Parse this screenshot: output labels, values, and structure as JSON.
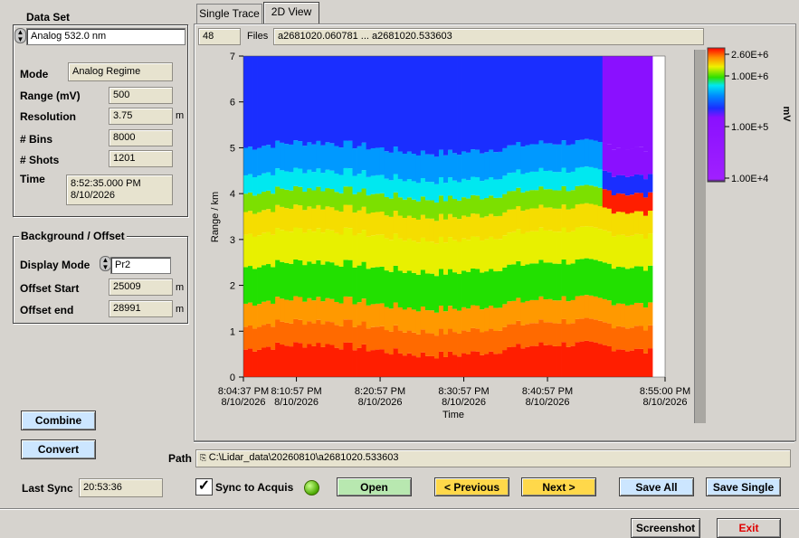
{
  "dataset": {
    "group_label": "Data Set",
    "channel": "Analog 532.0 nm",
    "mode_label": "Mode",
    "mode": "Analog Regime",
    "range_label": "Range (mV)",
    "range": "500",
    "resolution_label": "Resolution",
    "resolution": "3.75",
    "resolution_unit": "m",
    "bins_label": "# Bins",
    "bins": "8000",
    "shots_label": "# Shots",
    "shots": "1201",
    "time_label": "Time",
    "time": "8:52:35.000 PM",
    "date": "8/10/2026"
  },
  "background": {
    "group_label": "Background / Offset",
    "display_mode_label": "Display Mode",
    "display_mode": "Pr2",
    "offset_start_label": "Offset Start",
    "offset_start": "25009",
    "offset_start_unit": "m",
    "offset_end_label": "Offset end",
    "offset_end": "28991",
    "offset_end_unit": "m"
  },
  "buttons": {
    "combine": "Combine",
    "convert": "Convert",
    "open": "Open",
    "previous": "< Previous",
    "next": "Next  >",
    "save_all": "Save All",
    "save_single": "Save Single",
    "screenshot": "Screenshot",
    "exit": "Exit"
  },
  "tabs": [
    "Single Trace",
    "2D View"
  ],
  "files": {
    "count": "48",
    "label": "Files",
    "range": "a2681020.060781 ... a2681020.533603"
  },
  "path": {
    "label": "Path",
    "value": "C:\\Lidar_data\\20260810\\a2681020.533603"
  },
  "sync": {
    "last_sync_label": "Last Sync",
    "last_sync": "20:53:36",
    "checkbox_label": "Sync to Acquis",
    "checked": true
  },
  "chart_data": {
    "type": "heatmap",
    "ylabel": "Range / km",
    "xlabel": "Time",
    "ylim": [
      0,
      7
    ],
    "y_ticks": [
      "0",
      "1",
      "2",
      "3",
      "4",
      "5",
      "6",
      "7"
    ],
    "x_ticks": [
      {
        "time": "8:04:37 PM",
        "date": "8/10/2026"
      },
      {
        "time": "8:10:57 PM",
        "date": "8/10/2026"
      },
      {
        "time": "8:20:57 PM",
        "date": "8/10/2026"
      },
      {
        "time": "8:30:57 PM",
        "date": "8/10/2026"
      },
      {
        "time": "8:40:57 PM",
        "date": "8/10/2026"
      },
      {
        "time": "8:55:00 PM",
        "date": "8/10/2026"
      }
    ],
    "colorbar": {
      "unit": "mV",
      "labels": [
        "2.60E+6",
        "1.00E+6",
        "1.00E+5",
        "1.00E+4"
      ]
    },
    "layers_km": [
      {
        "from": 0.0,
        "to": 0.6,
        "color": "#ff1e00"
      },
      {
        "from": 0.6,
        "to": 1.1,
        "color": "#ff6a00"
      },
      {
        "from": 1.1,
        "to": 1.6,
        "color": "#ff9900"
      },
      {
        "from": 1.6,
        "to": 2.4,
        "color": "#22e000"
      },
      {
        "from": 2.4,
        "to": 3.1,
        "color": "#e8f000"
      },
      {
        "from": 3.1,
        "to": 3.6,
        "color": "#f5dd00"
      },
      {
        "from": 3.6,
        "to": 4.0,
        "color": "#7ce000"
      },
      {
        "from": 4.0,
        "to": 4.4,
        "color": "#00e8f0"
      },
      {
        "from": 4.4,
        "to": 5.0,
        "color": "#0099ff"
      },
      {
        "from": 5.0,
        "to": 7.0,
        "color": "#1a2eff"
      }
    ]
  }
}
